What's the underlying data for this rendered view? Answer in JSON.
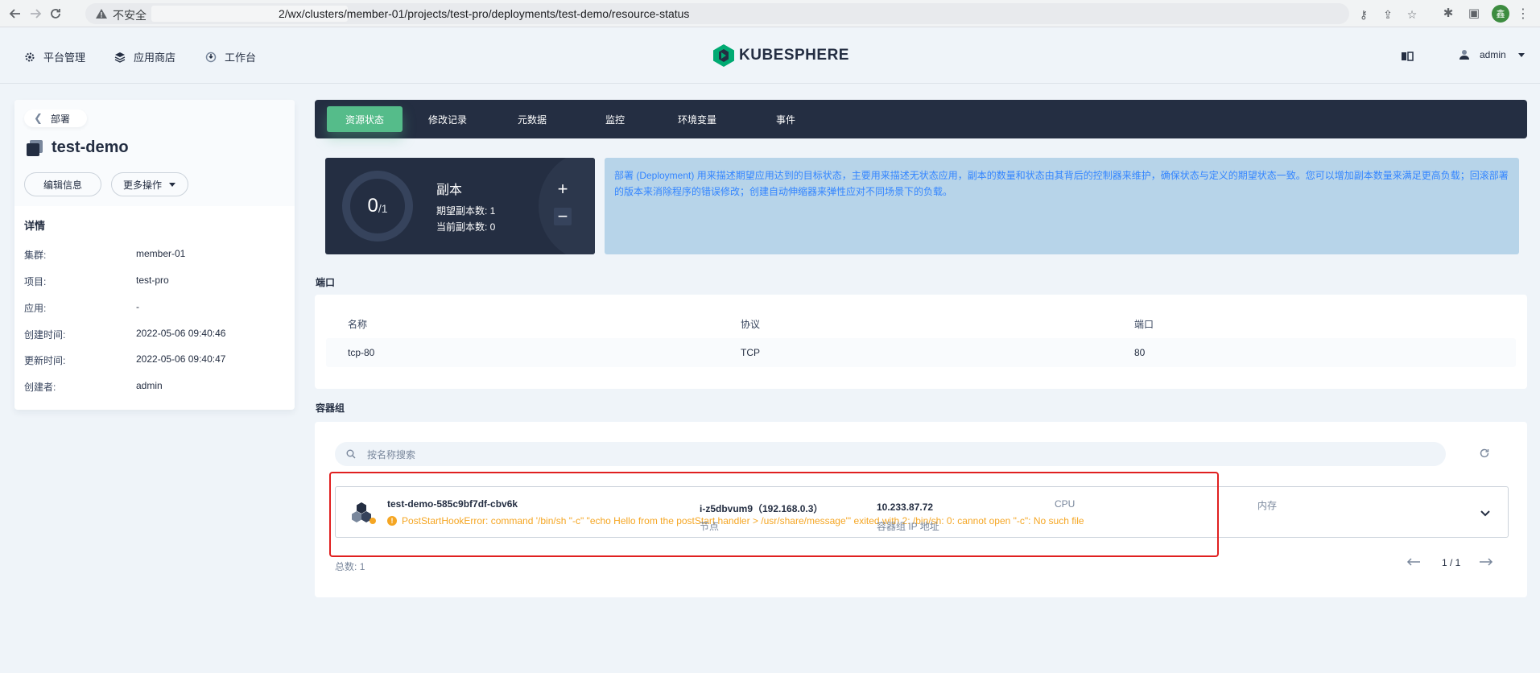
{
  "browser": {
    "security_label": "不安全",
    "url": "2/wx/clusters/member-01/projects/test-pro/deployments/test-demo/resource-status",
    "profile_initial": "鑫"
  },
  "header": {
    "nav": [
      {
        "label": "平台管理",
        "icon": "gear-icon"
      },
      {
        "label": "应用商店",
        "icon": "app-store-icon"
      },
      {
        "label": "工作台",
        "icon": "workbench-icon"
      }
    ],
    "logo_text": "KUBESPHERE",
    "user": "admin"
  },
  "left_panel": {
    "back_label": "部署",
    "title": "test-demo",
    "edit_button": "编辑信息",
    "more_button": "更多操作",
    "details_heading": "详情",
    "details": [
      {
        "key": "集群:",
        "value": "member-01"
      },
      {
        "key": "项目:",
        "value": "test-pro"
      },
      {
        "key": "应用:",
        "value": "-"
      },
      {
        "key": "创建时间:",
        "value": "2022-05-06 09:40:46"
      },
      {
        "key": "更新时间:",
        "value": "2022-05-06 09:40:47"
      },
      {
        "key": "创建者:",
        "value": "admin"
      }
    ]
  },
  "tabs": [
    "资源状态",
    "修改记录",
    "元数据",
    "监控",
    "环境变量",
    "事件"
  ],
  "active_tab": "资源状态",
  "replicas": {
    "current": "0",
    "desired": "/1",
    "title": "副本",
    "desired_line": "期望副本数: 1",
    "current_line": "当前副本数: 0",
    "ratio": 0
  },
  "info_text": "部署 (Deployment) 用来描述期望应用达到的目标状态，主要用来描述无状态应用，副本的数量和状态由其背后的控制器来维护，确保状态与定义的期望状态一致。您可以增加副本数量来满足更高负载；回滚部署的版本来消除程序的错误修改；创建自动伸缩器来弹性应对不同场景下的负载。",
  "ports": {
    "section_label": "端口",
    "headers": [
      "名称",
      "协议",
      "端口"
    ],
    "rows": [
      {
        "name": "tcp-80",
        "protocol": "TCP",
        "port": "80"
      }
    ]
  },
  "pods": {
    "section_label": "容器组",
    "search_placeholder": "按名称搜索",
    "items": [
      {
        "name": "test-demo-585c9bf7df-cbv6k",
        "error": "PostStartHookError: command '/bin/sh \"-c\" \"echo Hello from the postStart handler > /usr/share/message\"' exited with 2: /bin/sh: 0: cannot open \"-c\": No such file",
        "node_value": "i-z5dbvum9（192.168.0.3）",
        "node_label": "节点",
        "ip_value": "10.233.87.72",
        "ip_label": "容器组 IP 地址",
        "cpu_label": "CPU",
        "memory_label": "内存"
      }
    ],
    "total_label": "总数:",
    "total": "1",
    "page": "1 / 1"
  },
  "colors": {
    "accent": "#55bc8a",
    "dark": "#242e42",
    "warning": "#f5a623",
    "highlight": "#e02020",
    "info_bg": "#b7d4e9"
  }
}
